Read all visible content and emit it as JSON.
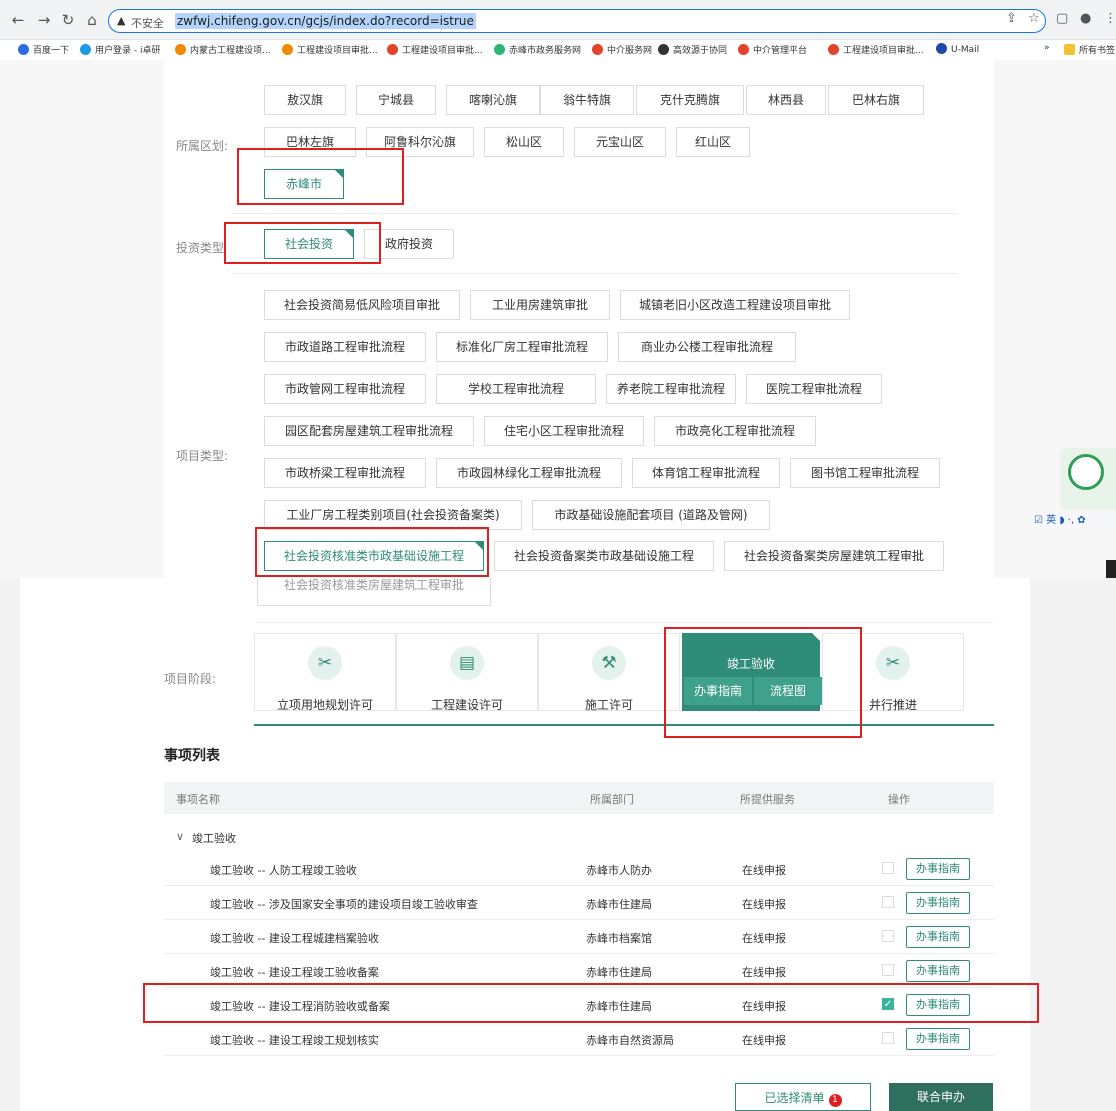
{
  "browser": {
    "insecure_label": "不安全",
    "url": "zwfwj.chifeng.gov.cn/gcjs/index.do?record=istrue",
    "bookmarks": [
      {
        "label": "百度一下",
        "color": "#2d6ce0"
      },
      {
        "label": "用户登录 - i卓研",
        "color": "#1a9be8"
      },
      {
        "label": "内蒙古工程建设项...",
        "color": "#f08a00"
      },
      {
        "label": "工程建设项目审批...",
        "color": "#f08a00"
      },
      {
        "label": "工程建设项目审批...",
        "color": "#e0452b"
      },
      {
        "label": "赤峰市政务服务网",
        "color": "#2bb673"
      },
      {
        "label": "中介服务网",
        "color": "#e0452b"
      },
      {
        "label": "高效源于协同",
        "color": "#333333"
      },
      {
        "label": "中介管理平台",
        "color": "#e0452b"
      },
      {
        "label": "工程建设项目审批...",
        "color": "#e0452b"
      },
      {
        "label": "U-Mail",
        "color": "#1f4aa8"
      }
    ],
    "overflow": "»",
    "all_bookmarks": "所有书签"
  },
  "filters": {
    "region_label": "所属区划:",
    "regions": [
      "敖汉旗",
      "宁城县",
      "喀喇沁旗",
      "翁牛特旗",
      "克什克腾旗",
      "林西县",
      "巴林右旗",
      "巴林左旗",
      "阿鲁科尔沁旗",
      "松山区",
      "元宝山区",
      "红山区",
      "赤峰市"
    ],
    "investment_label": "投资类型",
    "investments": [
      "社会投资",
      "政府投资"
    ],
    "project_type_label": "项目类型:",
    "project_types": [
      "社会投资简易低风险项目审批",
      "工业用房建筑审批",
      "城镇老旧小区改造工程建设项目审批",
      "市政道路工程审批流程",
      "标准化厂房工程审批流程",
      "商业办公楼工程审批流程",
      "市政管网工程审批流程",
      "学校工程审批流程",
      "养老院工程审批流程",
      "医院工程审批流程",
      "园区配套房屋建筑工程审批流程",
      "住宅小区工程审批流程",
      "市政亮化工程审批流程",
      "市政桥梁工程审批流程",
      "市政园林绿化工程审批流程",
      "体育馆工程审批流程",
      "图书馆工程审批流程",
      "工业厂房工程类别项目(社会投资备案类)",
      "市政基础设施配套项目 (道路及管网)",
      "社会投资核准类市政基础设施工程",
      "社会投资备案类市政基础设施工程",
      "社会投资备案类房屋建筑工程审批",
      "社会投资核准类房屋建筑工程审批"
    ]
  },
  "stages": {
    "label": "项目阶段:",
    "items": [
      "立项用地规划许可",
      "工程建设许可",
      "施工许可",
      "竣工验收",
      "并行推进"
    ],
    "active_guide": "办事指南",
    "active_flow": "流程图"
  },
  "list": {
    "title": "事项列表",
    "headers": [
      "事项名称",
      "所属部门",
      "所提供服务",
      "操作"
    ],
    "group": "竣工验收",
    "group_caret": "∨",
    "rows": [
      {
        "name": "竣工验收 -- 人防工程竣工验收",
        "dept": "赤峰市人防办",
        "service": "在线申报",
        "action": "办事指南",
        "checked": false
      },
      {
        "name": "竣工验收 -- 涉及国家安全事项的建设项目竣工验收审查",
        "dept": "赤峰市住建局",
        "service": "在线申报",
        "action": "办事指南",
        "checked": false
      },
      {
        "name": "竣工验收 -- 建设工程城建档案验收",
        "dept": "赤峰市档案馆",
        "service": "在线申报",
        "action": "办事指南",
        "checked": false
      },
      {
        "name": "竣工验收 -- 建设工程竣工验收备案",
        "dept": "赤峰市住建局",
        "service": "在线申报",
        "action": "办事指南",
        "checked": false
      },
      {
        "name": "竣工验收 -- 建设工程消防验收或备案",
        "dept": "赤峰市住建局",
        "service": "在线申报",
        "action": "办事指南",
        "checked": true
      },
      {
        "name": "竣工验收 -- 建设工程竣工规划核实",
        "dept": "赤峰市自然资源局",
        "service": "在线申报",
        "action": "办事指南",
        "checked": false
      }
    ],
    "selected_label": "已选择清单",
    "selected_count": "1",
    "apply_label": "联合申办"
  },
  "widget": {
    "ime_text": "☑ 英 ◗ ·, ✿"
  },
  "colors": {
    "accent": "#2f8c78",
    "annotation": "#e02020"
  }
}
